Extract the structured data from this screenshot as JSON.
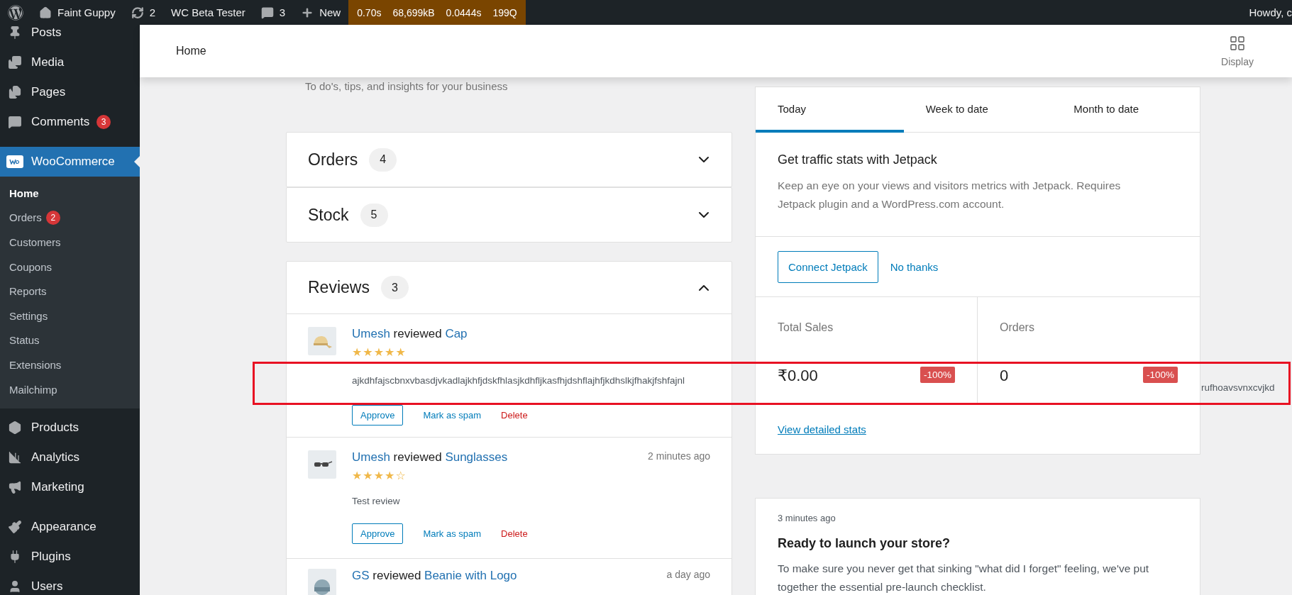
{
  "admin_bar": {
    "site": "Faint Guppy",
    "updates": "2",
    "plugin": "WC Beta Tester",
    "comments": "3",
    "new": "New",
    "debug": [
      "0.70s",
      "68,699kB",
      "0.0444s",
      "199Q"
    ],
    "greeting": "Howdy, c"
  },
  "sidebar": {
    "items": [
      {
        "label": "Posts",
        "selected": false
      },
      {
        "label": "Media",
        "selected": false
      },
      {
        "label": "Pages",
        "selected": false
      },
      {
        "label": "Comments",
        "badge": "3",
        "selected": false
      },
      {
        "label": "WooCommerce",
        "selected": true,
        "children": [
          {
            "label": "Home",
            "selected": true
          },
          {
            "label": "Orders",
            "badge": "2",
            "selected": false
          },
          {
            "label": "Customers",
            "selected": false
          },
          {
            "label": "Coupons",
            "selected": false
          },
          {
            "label": "Reports",
            "selected": false
          },
          {
            "label": "Settings",
            "selected": false
          },
          {
            "label": "Status",
            "selected": false
          },
          {
            "label": "Extensions",
            "selected": false
          },
          {
            "label": "Mailchimp",
            "selected": false
          }
        ]
      },
      {
        "label": "Products",
        "selected": false
      },
      {
        "label": "Analytics",
        "selected": false
      },
      {
        "label": "Marketing",
        "selected": false
      },
      {
        "label": "Appearance",
        "selected": false
      },
      {
        "label": "Plugins",
        "selected": false
      },
      {
        "label": "Users",
        "selected": false
      }
    ]
  },
  "header": {
    "title": "Home",
    "display": "Display"
  },
  "subtitle": "To do's, tips, and insights for your business",
  "panels": [
    {
      "title": "Orders",
      "count": "4",
      "expanded": false
    },
    {
      "title": "Stock",
      "count": "5",
      "expanded": false
    },
    {
      "title": "Reviews",
      "count": "3",
      "expanded": true
    }
  ],
  "reviews": [
    {
      "author": "Umesh",
      "verb": "reviewed",
      "product": "Cap",
      "stars": 5,
      "text": "ajkdhfajscbnxvbasdjvkadlajkhfjdskfhlasjkdhfljkasfhjdshflajhfjkdhslkjfhakjfshfajnl",
      "actions": [
        "Approve",
        "Mark as spam",
        "Delete"
      ]
    },
    {
      "author": "Umesh",
      "verb": "reviewed",
      "product": "Sunglasses",
      "time": "2 minutes ago",
      "stars": 4,
      "text": "Test review",
      "actions": [
        "Approve",
        "Mark as spam",
        "Delete"
      ]
    },
    {
      "author": "GS",
      "verb": "reviewed",
      "product": "Beanie with Logo",
      "time": "a day ago"
    }
  ],
  "overflow_text": "rufhoavsvnxcvjkd",
  "stats": {
    "tabs": [
      {
        "label": "Today",
        "selected": true
      },
      {
        "label": "Week to date",
        "selected": false
      },
      {
        "label": "Month to date",
        "selected": false
      }
    ],
    "jetpack": {
      "title": "Get traffic stats with Jetpack",
      "text": "Keep an eye on your views and visitors metrics with Jetpack. Requires Jetpack plugin and a WordPress.com account.",
      "connect": "Connect Jetpack",
      "dismiss": "No thanks"
    },
    "metrics": [
      {
        "label": "Total Sales",
        "value": "₹0.00",
        "delta": "-100%"
      },
      {
        "label": "Orders",
        "value": "0",
        "delta": "-100%"
      }
    ],
    "link": "View detailed stats"
  },
  "task_card": {
    "time": "3 minutes ago",
    "title": "Ready to launch your store?",
    "text": "To make sure you never get that sinking \"what did I forget\" feeling, we've put together the essential pre-launch checklist."
  },
  "annotation": {
    "kind": "rectangle"
  }
}
